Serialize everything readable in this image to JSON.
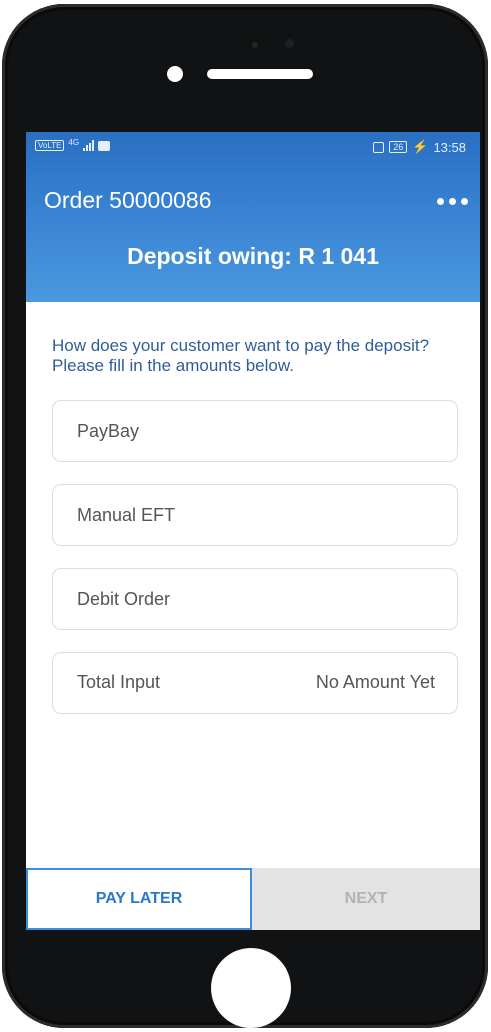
{
  "status_bar": {
    "network_badge": "VoLTE",
    "network_type": "4G",
    "battery": "26",
    "time": "13:58"
  },
  "header": {
    "title": "Order 50000086",
    "deposit_text": "Deposit owing: R 1 041"
  },
  "prompt": "How does your customer want to pay the deposit? Please fill in the amounts below.",
  "fields": {
    "paybay": {
      "placeholder": "PayBay",
      "value": ""
    },
    "manual_eft": {
      "placeholder": "Manual EFT",
      "value": ""
    },
    "debit_order": {
      "placeholder": "Debit Order",
      "value": ""
    },
    "total": {
      "label": "Total Input",
      "value": "No Amount Yet"
    }
  },
  "footer": {
    "pay_later_label": "PAY LATER",
    "next_label": "NEXT"
  },
  "colors": {
    "header_blue": "#3b86d4",
    "prompt_text": "#2f5d98",
    "pay_later_border": "#3a8fdd",
    "next_disabled_bg": "#e3e3e3"
  },
  "icons": [
    "signal-icon",
    "message-icon",
    "nfc-icon",
    "battery-icon",
    "charging-icon",
    "more-options-icon"
  ]
}
